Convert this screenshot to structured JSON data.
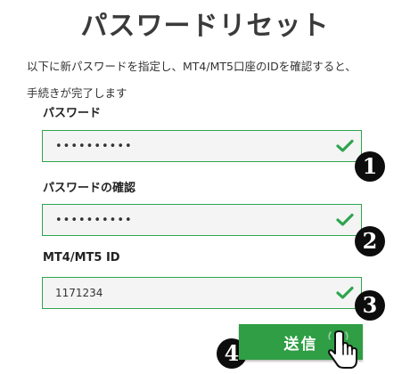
{
  "title": "パスワードリセット",
  "description": {
    "line1": "以下に新パスワードを指定し、MT4/MT5口座のIDを確認すると、",
    "line2": "手続きが完了します"
  },
  "fields": [
    {
      "label": "パスワード",
      "value": "••••••••••",
      "valid": true,
      "step": "1"
    },
    {
      "label": "パスワードの確認",
      "value": "••••••••••",
      "valid": true,
      "step": "2"
    },
    {
      "label": "MT4/MT5 ID",
      "value": "1171234",
      "valid": true,
      "step": "3"
    }
  ],
  "submit": {
    "label": "送信",
    "step": "4"
  },
  "colors": {
    "accent": "#2f9e44",
    "border": "#2ea44f",
    "badge": "#0d0d0d"
  },
  "icons": {
    "valid": "check-icon",
    "pointer": "hand-pointer-icon"
  }
}
